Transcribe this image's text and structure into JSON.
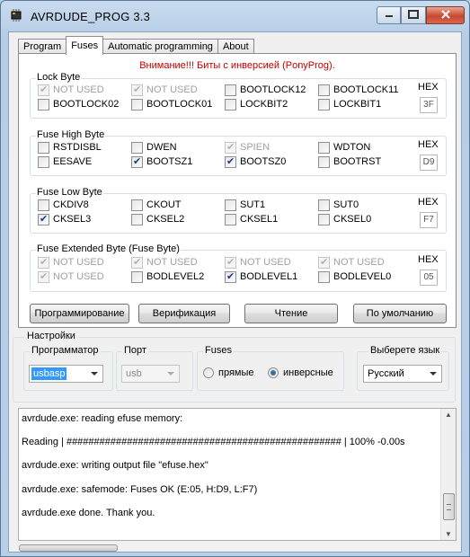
{
  "window": {
    "title": "AVRDUDE_PROG 3.3"
  },
  "tabs": [
    "Program",
    "Fuses",
    "Automatic programming",
    "About"
  ],
  "fuses": {
    "warning": "Внимание!!! Биты с инверсией (PonyProg).",
    "hex_label": "HEX",
    "lock": {
      "title": "Lock Byte",
      "hex": "3F",
      "bits": [
        {
          "label": "NOT USED",
          "checked": true,
          "disabled": true
        },
        {
          "label": "NOT USED",
          "checked": true,
          "disabled": true
        },
        {
          "label": "BOOTLOCK12",
          "checked": false,
          "disabled": false
        },
        {
          "label": "BOOTLOCK11",
          "checked": false,
          "disabled": false
        },
        {
          "label": "BOOTLOCK02",
          "checked": false,
          "disabled": false
        },
        {
          "label": "BOOTLOCK01",
          "checked": false,
          "disabled": false
        },
        {
          "label": "LOCKBIT2",
          "checked": false,
          "disabled": false
        },
        {
          "label": "LOCKBIT1",
          "checked": false,
          "disabled": false
        }
      ]
    },
    "high": {
      "title": "Fuse High Byte",
      "hex": "D9",
      "bits": [
        {
          "label": "RSTDISBL",
          "checked": false,
          "disabled": false
        },
        {
          "label": "DWEN",
          "checked": false,
          "disabled": false
        },
        {
          "label": "SPIEN",
          "checked": true,
          "disabled": true
        },
        {
          "label": "WDTON",
          "checked": false,
          "disabled": false
        },
        {
          "label": "EESAVE",
          "checked": false,
          "disabled": false
        },
        {
          "label": "BOOTSZ1",
          "checked": true,
          "disabled": false
        },
        {
          "label": "BOOTSZ0",
          "checked": true,
          "disabled": false
        },
        {
          "label": "BOOTRST",
          "checked": false,
          "disabled": false
        }
      ]
    },
    "low": {
      "title": "Fuse Low Byte",
      "hex": "F7",
      "bits": [
        {
          "label": "CKDIV8",
          "checked": false,
          "disabled": false
        },
        {
          "label": "CKOUT",
          "checked": false,
          "disabled": false
        },
        {
          "label": "SUT1",
          "checked": false,
          "disabled": false
        },
        {
          "label": "SUT0",
          "checked": false,
          "disabled": false
        },
        {
          "label": "CKSEL3",
          "checked": true,
          "disabled": false
        },
        {
          "label": "CKSEL2",
          "checked": false,
          "disabled": false
        },
        {
          "label": "CKSEL1",
          "checked": false,
          "disabled": false
        },
        {
          "label": "CKSEL0",
          "checked": false,
          "disabled": false
        }
      ]
    },
    "ext": {
      "title": "Fuse Extended Byte (Fuse Byte)",
      "hex": "05",
      "bits": [
        {
          "label": "NOT USED",
          "checked": true,
          "disabled": true
        },
        {
          "label": "NOT USED",
          "checked": true,
          "disabled": true
        },
        {
          "label": "NOT USED",
          "checked": true,
          "disabled": true
        },
        {
          "label": "NOT USED",
          "checked": true,
          "disabled": true
        },
        {
          "label": "NOT USED",
          "checked": true,
          "disabled": true
        },
        {
          "label": "BODLEVEL2",
          "checked": false,
          "disabled": false
        },
        {
          "label": "BODLEVEL1",
          "checked": true,
          "disabled": false
        },
        {
          "label": "BODLEVEL0",
          "checked": false,
          "disabled": false
        }
      ]
    },
    "buttons": {
      "program": "Программирование",
      "verify": "Верификация",
      "read": "Чтение",
      "default": "По умолчанию"
    }
  },
  "settings": {
    "title": "Настройки",
    "programmer": {
      "label": "Программатор",
      "value": "usbasp"
    },
    "port": {
      "label": "Порт",
      "value": "usb"
    },
    "fuses": {
      "label": "Fuses",
      "direct": "прямые",
      "inverse": "инверсные",
      "selected": "inverse"
    },
    "language": {
      "label": "Выберете язык",
      "value": "Русский"
    }
  },
  "log": [
    "avrdude.exe: reading efuse memory:",
    "Reading | ################################################## | 100% -0.00s",
    "avrdude.exe: writing output file \"efuse.hex\"",
    "avrdude.exe: safemode: Fuses OK (E:05, H:D9, L:F7)",
    "avrdude.exe done.  Thank you."
  ],
  "icons": {
    "app": "chip-icon",
    "minimize": "minimize-icon",
    "maximize": "maximize-icon",
    "close": "close-icon",
    "dropdown": "chevron-down-icon"
  },
  "colors": {
    "warning": "#c00000",
    "titlebar": "#bcd3ea",
    "close_button": "#c8482e"
  }
}
